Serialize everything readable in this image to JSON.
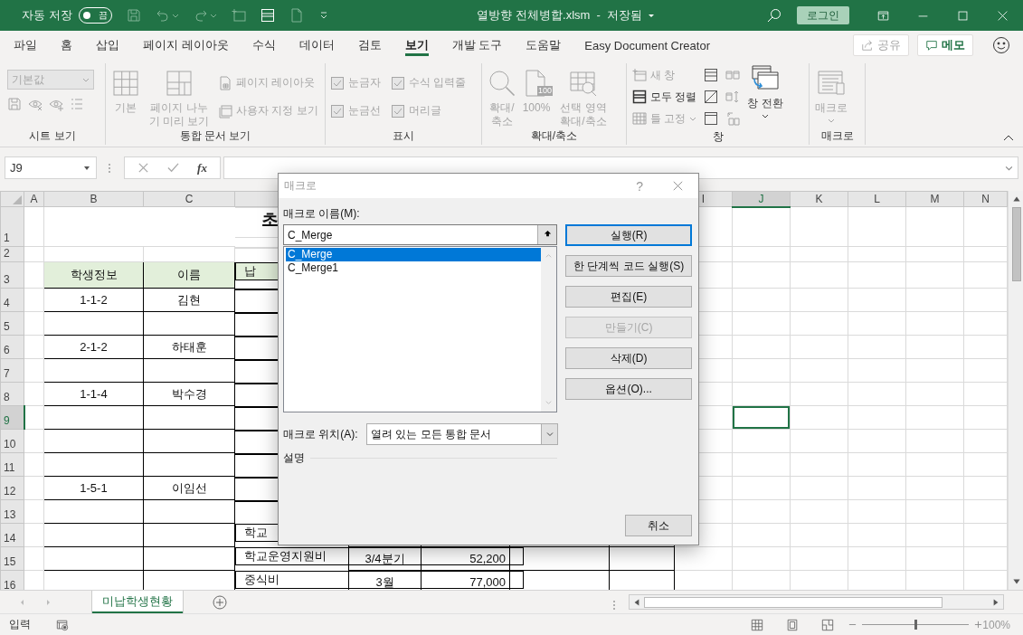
{
  "title_bar": {
    "autosave_label": "자동 저장",
    "autosave_toggle": {
      "on": false,
      "label": "끔"
    },
    "title": "열방향 전체병합.xlsm  -  저장됨",
    "signin": "로그인"
  },
  "menu_tabs": [
    {
      "label": "파일",
      "selected": false
    },
    {
      "label": "홈",
      "selected": false
    },
    {
      "label": "삽입",
      "selected": false
    },
    {
      "label": "페이지 레이아웃",
      "selected": false
    },
    {
      "label": "수식",
      "selected": false
    },
    {
      "label": "데이터",
      "selected": false
    },
    {
      "label": "검토",
      "selected": false
    },
    {
      "label": "보기",
      "selected": true
    },
    {
      "label": "개발 도구",
      "selected": false
    },
    {
      "label": "도움말",
      "selected": false
    },
    {
      "label": "Easy Document Creator",
      "selected": false
    }
  ],
  "share_button": {
    "label": "공유",
    "disabled": true
  },
  "memo_button": {
    "label": "메모"
  },
  "ribbon_groups": [
    {
      "label": "시트 보기",
      "items": [
        {
          "kind": "dropdown",
          "label": "기본값",
          "disabled": true
        },
        {
          "kind": "icon",
          "disabled": true
        },
        {
          "kind": "icon",
          "disabled": true
        },
        {
          "kind": "icon",
          "disabled": true
        },
        {
          "kind": "icon",
          "disabled": true
        }
      ]
    },
    {
      "label": "통합 문서 보기",
      "items": [
        {
          "kind": "large",
          "label": "기본",
          "disabled": true,
          "menu": false
        },
        {
          "kind": "large",
          "label": "페이지 나누기 미리 보기",
          "disabled": true,
          "menu": false
        },
        {
          "kind": "small",
          "label": "페이지 레이아웃",
          "disabled": true,
          "menu": false
        },
        {
          "kind": "small",
          "label": "사용자 지정 보기",
          "disabled": true,
          "menu": false
        }
      ]
    },
    {
      "label": "표시",
      "items": [
        {
          "kind": "check",
          "label": "눈금자",
          "checked": true,
          "disabled": true
        },
        {
          "kind": "check",
          "label": "수식 입력줄",
          "checked": true,
          "disabled": true
        },
        {
          "kind": "check",
          "label": "눈금선",
          "checked": true,
          "disabled": true
        },
        {
          "kind": "check",
          "label": "머리글",
          "checked": true,
          "disabled": true
        }
      ]
    },
    {
      "label": "확대/축소",
      "items": [
        {
          "kind": "large",
          "label": "확대/축소",
          "disabled": true,
          "menu": false
        },
        {
          "kind": "large",
          "label": "100%",
          "icon_text": "100",
          "disabled": true,
          "menu": false
        },
        {
          "kind": "large",
          "label": "선택 영역 확대/축소",
          "disabled": true,
          "menu": false
        }
      ]
    },
    {
      "label": "창",
      "items": [
        {
          "kind": "small",
          "label": "새 창",
          "disabled": true,
          "menu": false
        },
        {
          "kind": "small",
          "label": "모두 정렬",
          "disabled": false,
          "menu": false
        },
        {
          "kind": "small",
          "label": "틀 고정",
          "disabled": true,
          "menu": true
        },
        {
          "kind": "icon",
          "disabled": false
        },
        {
          "kind": "icon",
          "disabled": false
        },
        {
          "kind": "icon",
          "disabled": false
        },
        {
          "kind": "icon",
          "disabled": true
        },
        {
          "kind": "icon",
          "disabled": true
        },
        {
          "kind": "icon",
          "disabled": true
        },
        {
          "kind": "large",
          "label": "창 전환",
          "disabled": false,
          "menu": true
        }
      ]
    },
    {
      "label": "매크로",
      "items": [
        {
          "kind": "large",
          "label": "매크로",
          "disabled": true,
          "menu": true
        }
      ]
    }
  ],
  "formula_bar": {
    "name_box": "J9",
    "function_button": "fx"
  },
  "columns": [
    {
      "label": "A",
      "selected": false
    },
    {
      "label": "B",
      "selected": false
    },
    {
      "label": "C",
      "selected": false
    },
    {
      "label": "I",
      "selected": false
    },
    {
      "label": "J",
      "selected": true
    },
    {
      "label": "K",
      "selected": false
    },
    {
      "label": "L",
      "selected": false
    },
    {
      "label": "M",
      "selected": false
    },
    {
      "label": "N",
      "selected": false
    }
  ],
  "rows": [
    {
      "label": "1",
      "selected": false,
      "kind": "title",
      "cells": [
        null,
        null,
        null,
        "초"
      ]
    },
    {
      "label": "2",
      "selected": false,
      "kind": "spacer"
    },
    {
      "label": "3",
      "selected": false,
      "kind": "header",
      "cells": [
        null,
        "학생정보",
        "이름",
        "납"
      ]
    },
    {
      "label": "4",
      "selected": false,
      "kind": "body",
      "cells": [
        null,
        "1-1-2",
        "김현"
      ]
    },
    {
      "label": "5",
      "selected": false,
      "kind": "body"
    },
    {
      "label": "6",
      "selected": false,
      "kind": "body",
      "cells": [
        null,
        "2-1-2",
        "하태훈"
      ]
    },
    {
      "label": "7",
      "selected": false,
      "kind": "body"
    },
    {
      "label": "8",
      "selected": false,
      "kind": "body",
      "cells": [
        null,
        "1-1-4",
        "박수경"
      ]
    },
    {
      "label": "9",
      "selected": true,
      "kind": "body"
    },
    {
      "label": "10",
      "selected": false,
      "kind": "body"
    },
    {
      "label": "11",
      "selected": false,
      "kind": "body"
    },
    {
      "label": "12",
      "selected": false,
      "kind": "body",
      "cells": [
        null,
        "1-5-1",
        "이임선"
      ]
    },
    {
      "label": "13",
      "selected": false,
      "kind": "body"
    },
    {
      "label": "14",
      "selected": false,
      "kind": "body",
      "cells": [
        null,
        null,
        null,
        "학교"
      ]
    },
    {
      "label": "15",
      "selected": false,
      "kind": "body",
      "cells": [
        null,
        null,
        null,
        "학교운영지원비",
        "3/4분기",
        "52,200"
      ]
    },
    {
      "label": "16",
      "selected": false,
      "kind": "body",
      "cells": [
        null,
        null,
        null,
        "중식비",
        "3월",
        "77,000"
      ]
    }
  ],
  "sheet_tabs": [
    {
      "label": "미납학생현황",
      "selected": true
    }
  ],
  "status_bar": {
    "mode": "입력",
    "zoom": {
      "level": 0.5,
      "reading": "100%"
    }
  },
  "dialog": {
    "title": "매크로",
    "help": "?",
    "name_label": "매크로 이름(M):",
    "name_value": "C_Merge",
    "macros": [
      {
        "name": "C_Merge",
        "selected": true
      },
      {
        "name": "C_Merge1",
        "selected": false
      }
    ],
    "buttons": [
      {
        "label": "실행(R)",
        "default": true,
        "disabled": false
      },
      {
        "label": "한 단계씩 코드 실행(S)",
        "default": false,
        "disabled": false
      },
      {
        "label": "편집(E)",
        "default": false,
        "disabled": false
      },
      {
        "label": "만들기(C)",
        "default": false,
        "disabled": true
      },
      {
        "label": "삭제(D)",
        "default": false,
        "disabled": false
      },
      {
        "label": "옵션(O)...",
        "default": false,
        "disabled": false
      }
    ],
    "location_label": "매크로 위치(A):",
    "location_value": "열려 있는 모든 통합 문서",
    "description_label": "설명",
    "cancel": "취소"
  }
}
